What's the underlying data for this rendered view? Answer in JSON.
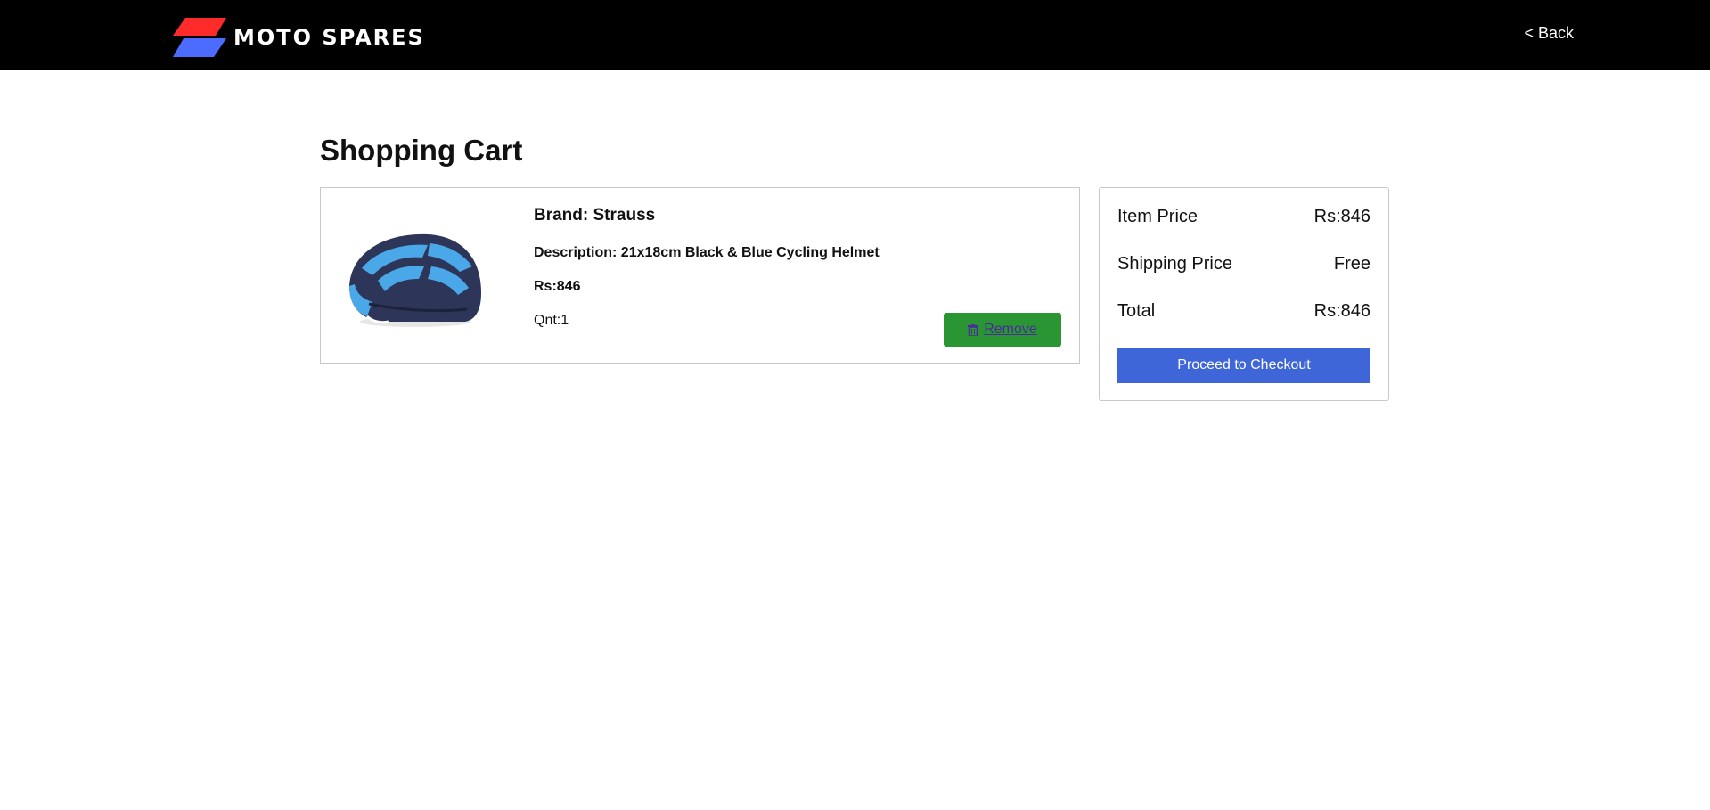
{
  "header": {
    "brand_name": "MOTO SPARES",
    "back_label": "< Back",
    "logo_colors": [
      "#ff2a2a",
      "#4c6bff"
    ]
  },
  "page": {
    "title": "Shopping Cart"
  },
  "cart": {
    "items": [
      {
        "brand_label": "Brand: ",
        "brand": "Strauss",
        "description_label": "Description: ",
        "description": "21x18cm Black & Blue Cycling Helmet",
        "price": "Rs:846",
        "quantity_label": "Qnt:",
        "quantity": "1",
        "remove_label": "Remove",
        "image_icon": "cycling-helmet-image"
      }
    ]
  },
  "summary": {
    "item_price_label": "Item Price",
    "item_price_value": "Rs:846",
    "shipping_label": "Shipping Price",
    "shipping_value": "Free",
    "total_label": "Total",
    "total_value": "Rs:846",
    "checkout_label": "Proceed to Checkout"
  },
  "colors": {
    "accent_blue": "#3f66d8",
    "remove_green": "#2a9633",
    "header_bg": "#000000"
  }
}
